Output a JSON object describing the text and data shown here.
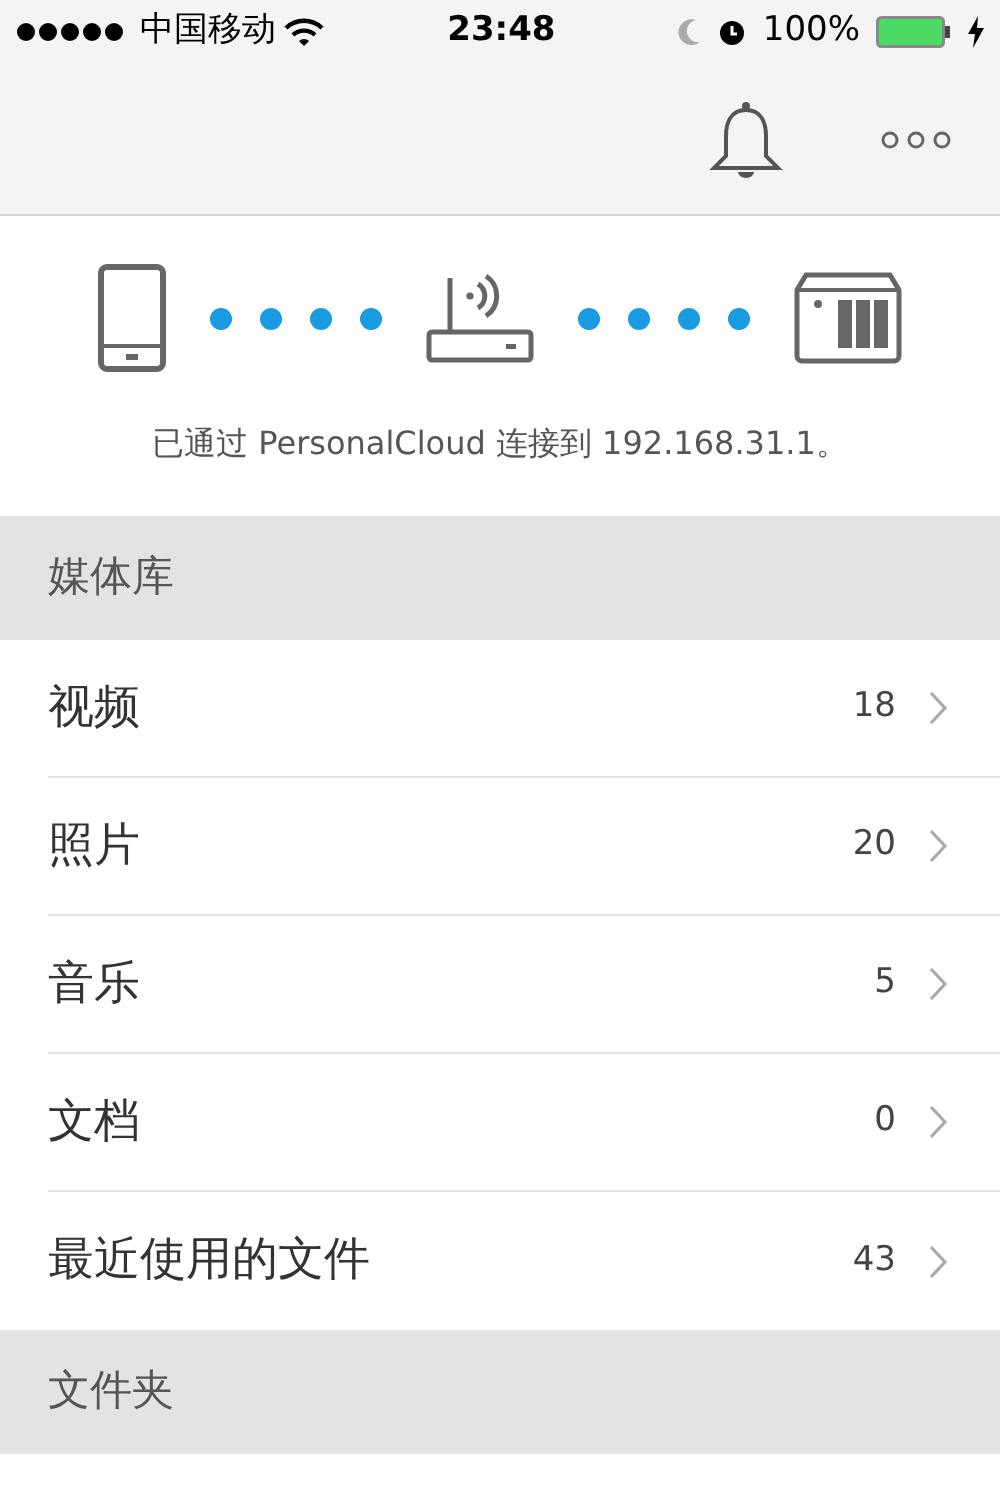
{
  "status_bar": {
    "carrier": "中国移动",
    "time": "23:48",
    "battery": "100%"
  },
  "connection": {
    "message": "已通过 PersonalCloud 连接到 192.168.31.1。"
  },
  "sections": [
    {
      "title": "媒体库",
      "items": [
        {
          "label": "视频",
          "count": "18"
        },
        {
          "label": "照片",
          "count": "20"
        },
        {
          "label": "音乐",
          "count": "5"
        },
        {
          "label": "文档",
          "count": "0"
        },
        {
          "label": "最近使用的文件",
          "count": "43"
        }
      ]
    },
    {
      "title": "文件夹"
    }
  ]
}
